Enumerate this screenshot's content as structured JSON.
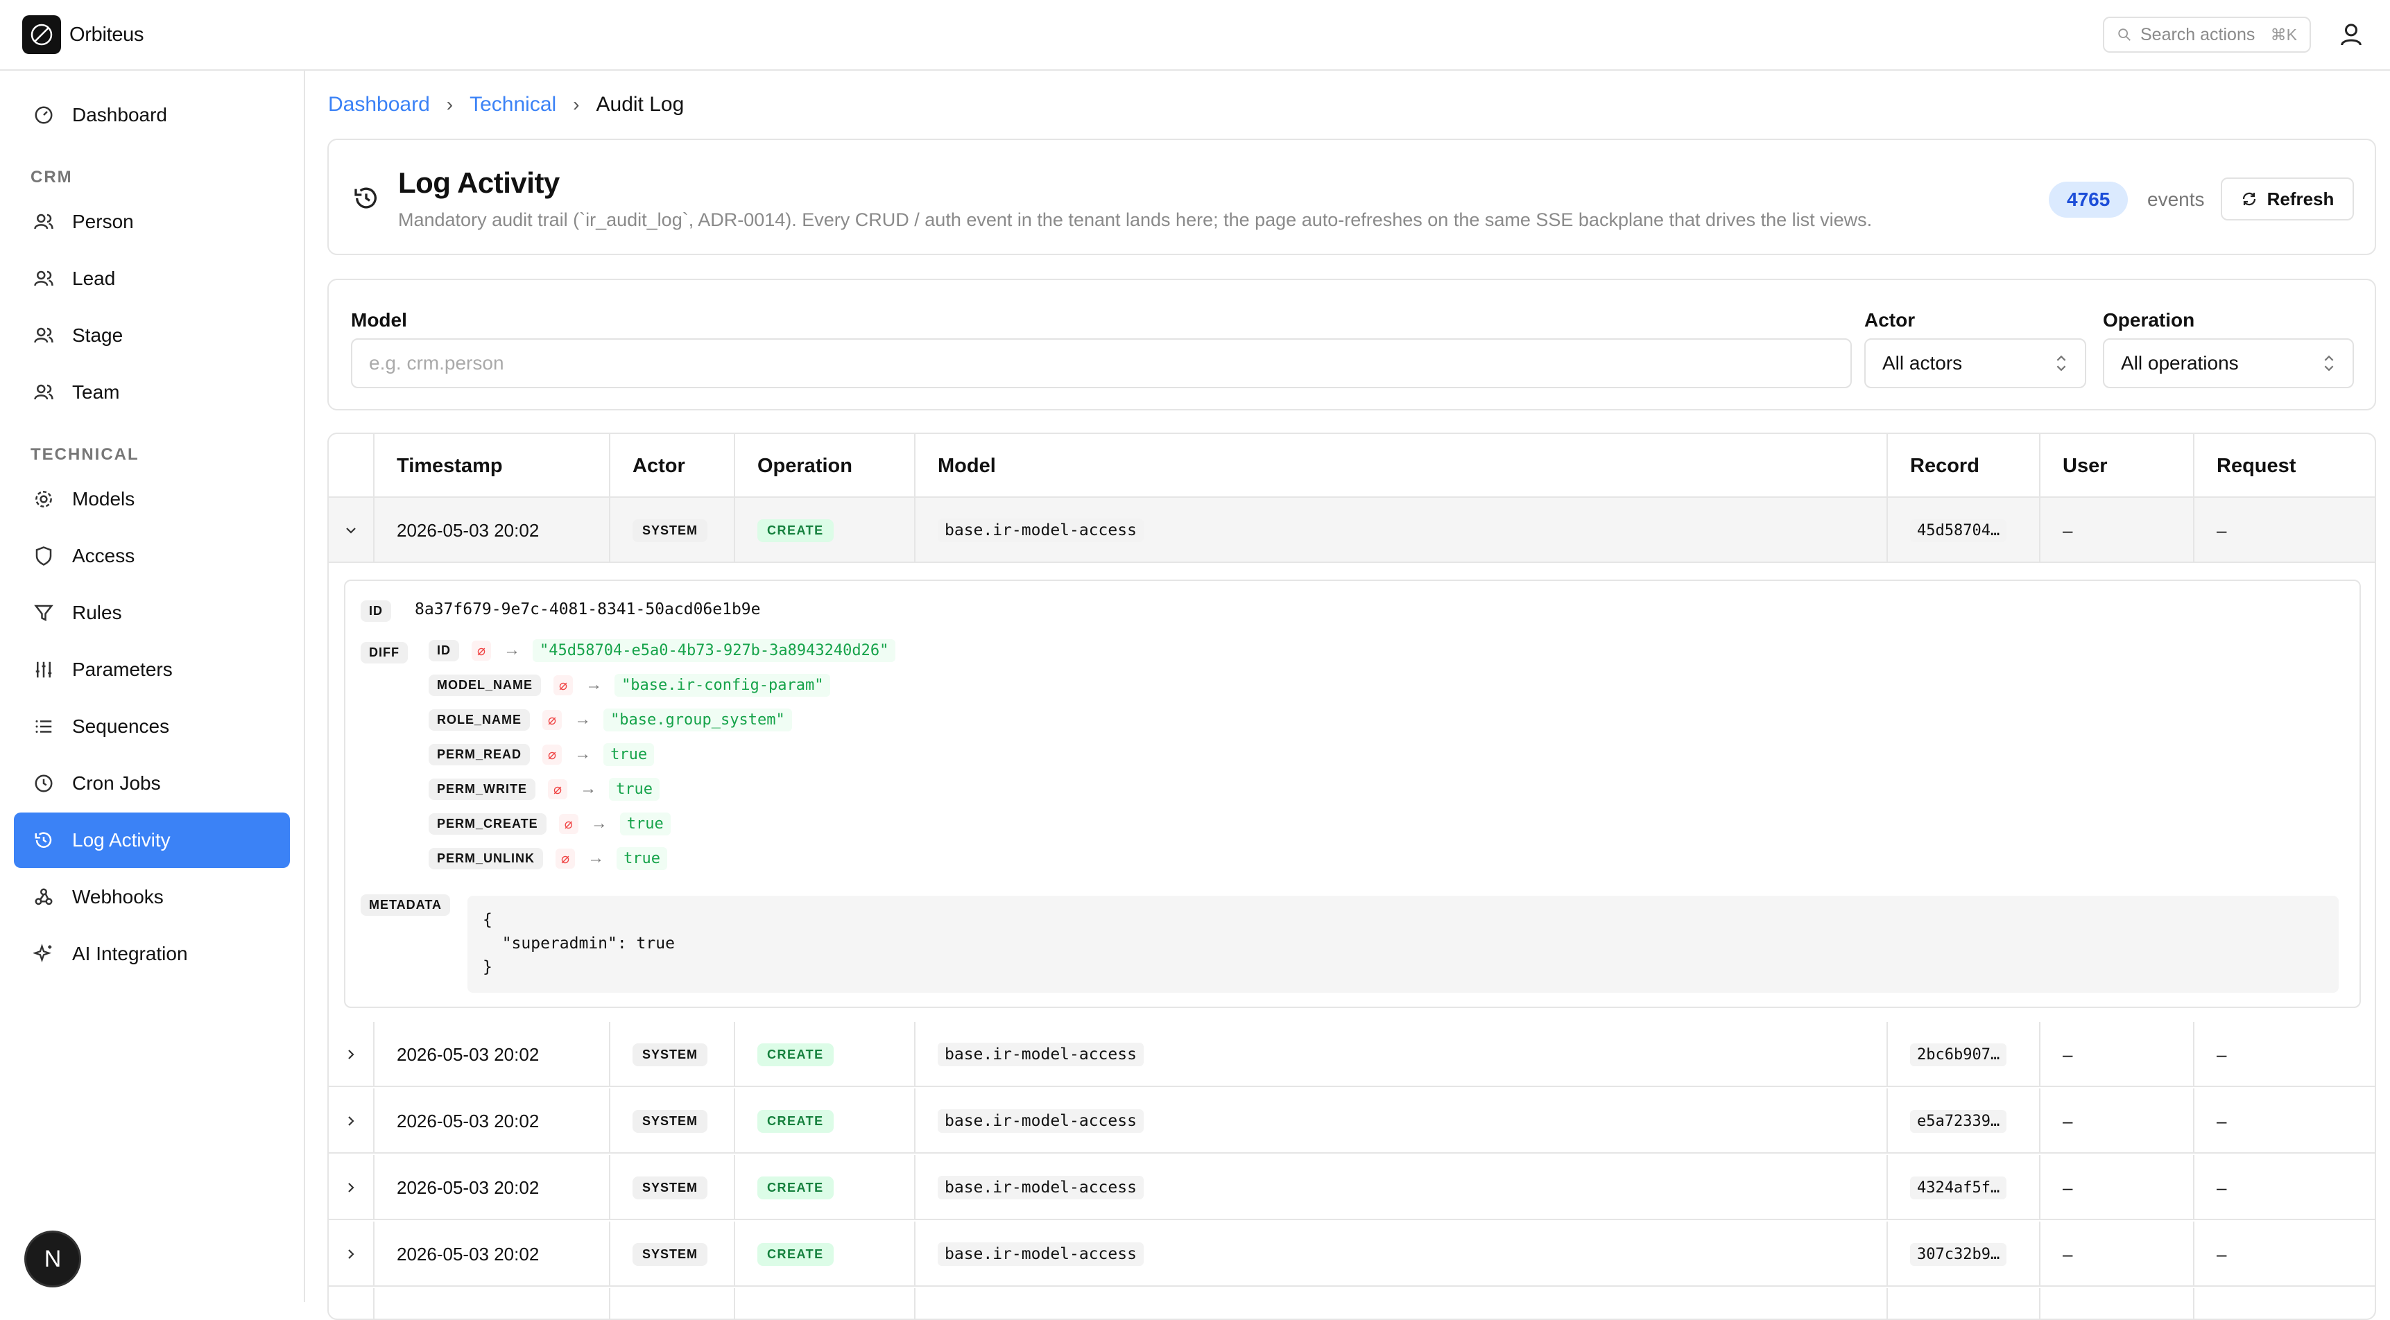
{
  "app": {
    "name": "Orbiteus"
  },
  "search": {
    "placeholder": "Search actions",
    "shortcut": "⌘K"
  },
  "sidebar": {
    "dashboard": "Dashboard",
    "sections": {
      "crm": "CRM",
      "technical": "TECHNICAL"
    },
    "crm_items": [
      "Person",
      "Lead",
      "Stage",
      "Team"
    ],
    "technical_items": [
      "Models",
      "Access",
      "Rules",
      "Parameters",
      "Sequences",
      "Cron Jobs",
      "Log Activity",
      "Webhooks",
      "AI Integration"
    ],
    "active": "Log Activity"
  },
  "breadcrumb": [
    "Dashboard",
    "Technical",
    "Audit Log"
  ],
  "header": {
    "title": "Log Activity",
    "description": "Mandatory audit trail (`ir_audit_log`, ADR-0014). Every CRUD / auth event in the tenant lands here; the page auto-refreshes on the same SSE backplane that drives the list views.",
    "count": "4765",
    "count_label": "events",
    "refresh_label": "Refresh"
  },
  "filters": {
    "model_label": "Model",
    "model_placeholder": "e.g. crm.person",
    "actor_label": "Actor",
    "actor_value": "All actors",
    "operation_label": "Operation",
    "operation_value": "All operations"
  },
  "table": {
    "columns": [
      "Timestamp",
      "Actor",
      "Operation",
      "Model",
      "Record",
      "User",
      "Request"
    ],
    "rows": [
      {
        "timestamp": "2026-05-03 20:02",
        "actor": "SYSTEM",
        "operation": "CREATE",
        "model": "base.ir-model-access",
        "record": "45d58704…",
        "user": "–",
        "request": "–"
      },
      {
        "timestamp": "2026-05-03 20:02",
        "actor": "SYSTEM",
        "operation": "CREATE",
        "model": "base.ir-model-access",
        "record": "2bc6b907…",
        "user": "–",
        "request": "–"
      },
      {
        "timestamp": "2026-05-03 20:02",
        "actor": "SYSTEM",
        "operation": "CREATE",
        "model": "base.ir-model-access",
        "record": "e5a72339…",
        "user": "–",
        "request": "–"
      },
      {
        "timestamp": "2026-05-03 20:02",
        "actor": "SYSTEM",
        "operation": "CREATE",
        "model": "base.ir-model-access",
        "record": "4324af5f…",
        "user": "–",
        "request": "–"
      },
      {
        "timestamp": "2026-05-03 20:02",
        "actor": "SYSTEM",
        "operation": "CREATE",
        "model": "base.ir-model-access",
        "record": "307c32b9…",
        "user": "–",
        "request": "–"
      }
    ],
    "detail": {
      "id_label": "ID",
      "id_value": "8a37f679-9e7c-4081-8341-50acd06e1b9e",
      "diff_label": "DIFF",
      "null_symbol": "⌀",
      "diff": [
        {
          "field": "ID",
          "value": "\"45d58704-e5a0-4b73-927b-3a8943240d26\""
        },
        {
          "field": "MODEL_NAME",
          "value": "\"base.ir-config-param\""
        },
        {
          "field": "ROLE_NAME",
          "value": "\"base.group_system\""
        },
        {
          "field": "PERM_READ",
          "value": "true"
        },
        {
          "field": "PERM_WRITE",
          "value": "true"
        },
        {
          "field": "PERM_CREATE",
          "value": "true"
        },
        {
          "field": "PERM_UNLINK",
          "value": "true"
        }
      ],
      "metadata_label": "METADATA",
      "metadata": "{\n  \"superadmin\": true\n}"
    }
  },
  "next_badge": "N"
}
